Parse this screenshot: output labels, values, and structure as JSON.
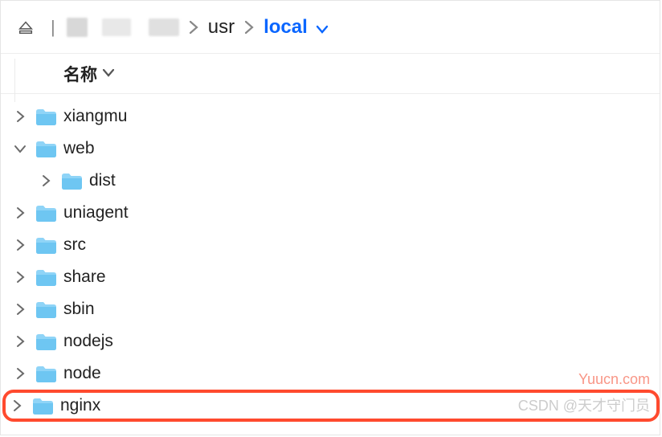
{
  "breadcrumb": {
    "items": [
      {
        "label": "usr",
        "active": false
      },
      {
        "label": "local",
        "active": true
      }
    ]
  },
  "header": {
    "name_column": "名称"
  },
  "tree": [
    {
      "label": "xiangmu",
      "expanded": false,
      "level": 0,
      "highlighted": false
    },
    {
      "label": "web",
      "expanded": true,
      "level": 0,
      "highlighted": false
    },
    {
      "label": "dist",
      "expanded": false,
      "level": 1,
      "highlighted": false
    },
    {
      "label": "uniagent",
      "expanded": false,
      "level": 0,
      "highlighted": false
    },
    {
      "label": "src",
      "expanded": false,
      "level": 0,
      "highlighted": false
    },
    {
      "label": "share",
      "expanded": false,
      "level": 0,
      "highlighted": false
    },
    {
      "label": "sbin",
      "expanded": false,
      "level": 0,
      "highlighted": false
    },
    {
      "label": "nodejs",
      "expanded": false,
      "level": 0,
      "highlighted": false
    },
    {
      "label": "node",
      "expanded": false,
      "level": 0,
      "highlighted": false
    },
    {
      "label": "nginx",
      "expanded": false,
      "level": 0,
      "highlighted": true
    }
  ],
  "watermarks": {
    "top_right": "Yuucn.com",
    "bottom_right": "CSDN @天才守门员"
  }
}
